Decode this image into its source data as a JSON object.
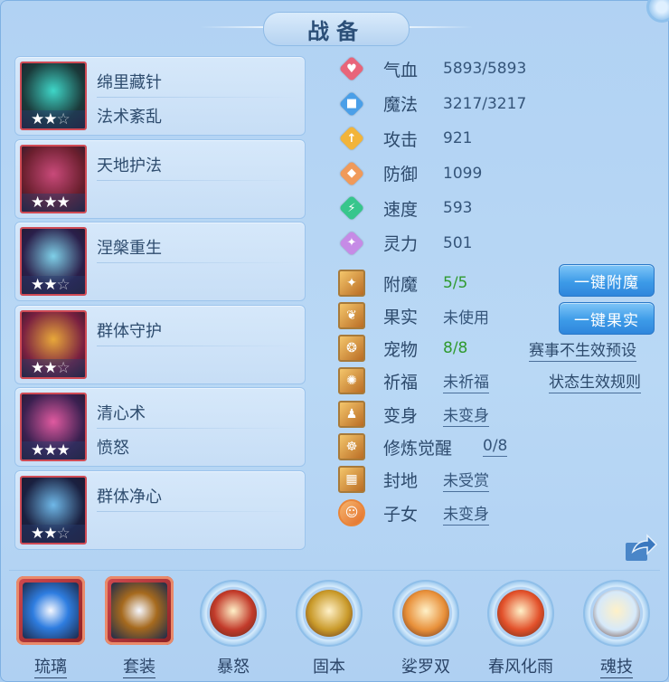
{
  "panel": {
    "title": "战备"
  },
  "skills": [
    {
      "name": "绵里藏针",
      "sub": "法术紊乱",
      "stars_filled": 2,
      "stars_total": 3
    },
    {
      "name": "天地护法",
      "sub": "",
      "stars_filled": 3,
      "stars_total": 3
    },
    {
      "name": "涅槃重生",
      "sub": "",
      "stars_filled": 2,
      "stars_total": 3
    },
    {
      "name": "群体守护",
      "sub": "",
      "stars_filled": 2,
      "stars_total": 3
    },
    {
      "name": "清心术",
      "sub": "愤怒",
      "stars_filled": 3,
      "stars_total": 3
    },
    {
      "name": "群体净心",
      "sub": "",
      "stars_filled": 2,
      "stars_total": 3
    }
  ],
  "stats": [
    {
      "label": "气血",
      "value": "5893/5893",
      "icon": "heart-icon",
      "color": "#e8657a"
    },
    {
      "label": "魔法",
      "value": "3217/3217",
      "icon": "mana-icon",
      "color": "#4a9fe8"
    },
    {
      "label": "攻击",
      "value": "921",
      "icon": "sword-icon",
      "color": "#f2b43a"
    },
    {
      "label": "防御",
      "value": "1099",
      "icon": "shield-icon",
      "color": "#f09a5a"
    },
    {
      "label": "速度",
      "value": "593",
      "icon": "lightning-icon",
      "color": "#37c68c"
    },
    {
      "label": "灵力",
      "value": "501",
      "icon": "spirit-icon",
      "color": "#c68be6"
    }
  ],
  "status": [
    {
      "label": "附魔",
      "value": "5/5",
      "style": "green",
      "icon": "enchant-icon"
    },
    {
      "label": "果实",
      "value": "未使用",
      "style": "plain",
      "icon": "fruit-icon"
    },
    {
      "label": "宠物",
      "value": "8/8",
      "style": "green",
      "icon": "pet-icon"
    },
    {
      "label": "祈福",
      "value": "未祈福",
      "style": "link",
      "icon": "blessing-icon"
    },
    {
      "label": "变身",
      "value": "未变身",
      "style": "link",
      "icon": "transform-icon"
    },
    {
      "label": "修炼觉醒",
      "value": "0/8",
      "style": "link",
      "icon": "cultivation-icon"
    },
    {
      "label": "封地",
      "value": "未受赏",
      "style": "link",
      "icon": "fief-icon"
    },
    {
      "label": "子女",
      "value": "未变身",
      "style": "link",
      "icon": "child-icon"
    }
  ],
  "buttons": {
    "enchant_all": "一键附魔",
    "fruit_all": "一键果实"
  },
  "links": {
    "event_preset": "赛事不生效预设",
    "status_rules": "状态生效规则"
  },
  "bottom": [
    {
      "label": "琉璃",
      "icon": "glaze-orb-icon",
      "shape": "square",
      "underline": true,
      "color": "#2e7de0"
    },
    {
      "label": "套装",
      "icon": "treasure-chest-icon",
      "shape": "square",
      "underline": true,
      "color": "#a66a1e"
    },
    {
      "label": "暴怒",
      "icon": "roaring-beast-icon",
      "shape": "ring",
      "underline": false,
      "color": "#c23a2a"
    },
    {
      "label": "固本",
      "icon": "meditating-monk-icon",
      "shape": "ring",
      "underline": false,
      "color": "#c99a2a"
    },
    {
      "label": "娑罗双",
      "icon": "palm-hand-icon",
      "shape": "ring",
      "underline": false,
      "color": "#e8903a"
    },
    {
      "label": "春风化雨",
      "icon": "spring-burst-icon",
      "shape": "ring",
      "underline": false,
      "color": "#e2502a"
    },
    {
      "label": "魂技",
      "icon": "soul-skill-icon",
      "shape": "ring",
      "underline": true,
      "color": "#d6e9fa"
    }
  ]
}
